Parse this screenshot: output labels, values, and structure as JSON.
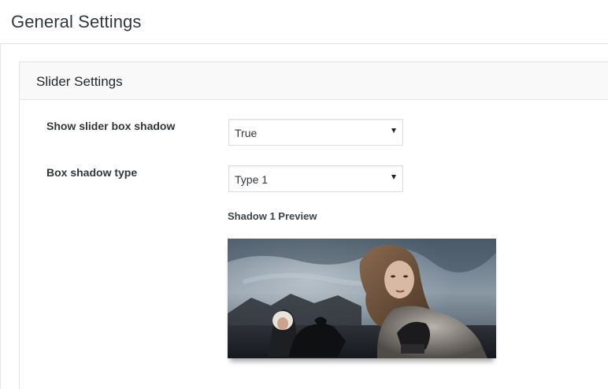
{
  "page": {
    "title": "General Settings"
  },
  "slider_settings": {
    "title": "Slider Settings",
    "fields": [
      {
        "label": "Show slider box shadow",
        "value": "True"
      },
      {
        "label": "Box shadow type",
        "value": "Type 1"
      }
    ],
    "preview": {
      "label": "Shadow 1 Preview"
    }
  }
}
